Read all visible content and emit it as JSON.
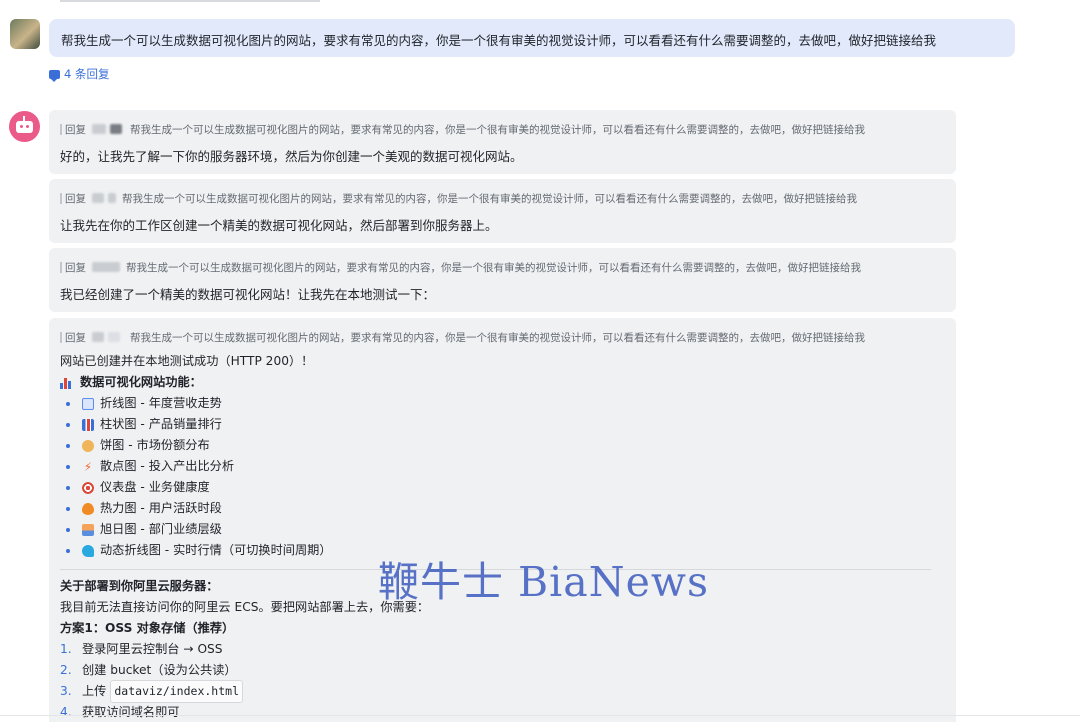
{
  "user_message": {
    "text": "帮我生成一个可以生成数据可视化图片的网站，要求有常见的内容，你是一个很有审美的视觉设计师，可以看看还有什么需要调整的，去做吧，做好把链接给我"
  },
  "thread": {
    "reply_count": "4 条回复"
  },
  "replies": [
    {
      "quote_prefix": "回复",
      "quote_text": "帮我生成一个可以生成数据可视化图片的网站，要求有常见的内容，你是一个很有审美的视觉设计师，可以看看还有什么需要调整的，去做吧，做好把链接给我",
      "text": "好的，让我先了解一下你的服务器环境，然后为你创建一个美观的数据可视化网站。"
    },
    {
      "quote_prefix": "回复",
      "quote_text": "帮我生成一个可以生成数据可视化图片的网站，要求有常见的内容，你是一个很有审美的视觉设计师，可以看看还有什么需要调整的，去做吧，做好把链接给我",
      "text": "让我先在你的工作区创建一个精美的数据可视化网站，然后部署到你服务器上。"
    },
    {
      "quote_prefix": "回复",
      "quote_text": "帮我生成一个可以生成数据可视化图片的网站，要求有常见的内容，你是一个很有审美的视觉设计师，可以看看还有什么需要调整的，去做吧，做好把链接给我",
      "text": "我已经创建了一个精美的数据可视化网站！让我先在本地测试一下："
    },
    {
      "quote_prefix": "回复",
      "quote_text": "帮我生成一个可以生成数据可视化图片的网站，要求有常见的内容，你是一个很有审美的视觉设计师，可以看看还有什么需要调整的，去做吧，做好把链接给我",
      "status_line": "网站已创建并在本地测试成功（HTTP 200）！",
      "features_heading": "数据可视化网站功能：",
      "features": [
        {
          "icon": "line-chart-icon",
          "color": "#5b8def",
          "text": "折线图 - 年度营收走势"
        },
        {
          "icon": "bar-chart-icon",
          "color": "#3a6fd8",
          "text": "柱状图 - 产品销量排行"
        },
        {
          "icon": "pie-chart-icon",
          "color": "#f0b45a",
          "text": "饼图 - 市场份额分布"
        },
        {
          "icon": "lightning-icon",
          "color": "#f06a3a",
          "text": "散点图 - 投入产出比分析"
        },
        {
          "icon": "target-icon",
          "color": "#e0453a",
          "text": "仪表盘 - 业务健康度"
        },
        {
          "icon": "fire-icon",
          "color": "#f08a24",
          "text": "热力图 - 用户活跃时段"
        },
        {
          "icon": "sunrise-icon",
          "color": "#f07a5a",
          "text": "旭日图 - 部门业绩层级"
        },
        {
          "icon": "wave-icon",
          "color": "#2aa8e0",
          "text": "动态折线图 - 实时行情（可切换时间周期）"
        }
      ],
      "deploy_heading": "关于部署到你阿里云服务器：",
      "deploy_intro": "我目前无法直接访问你的阿里云 ECS。要把网站部署上去，你需要：",
      "plan_title": "方案1：OSS 对象存储（推荐）",
      "steps": [
        {
          "n": "1.",
          "text": "登录阿里云控制台 → OSS"
        },
        {
          "n": "2.",
          "text": "创建 bucket（设为公共读）"
        },
        {
          "n": "3.",
          "text": "上传",
          "code": "dataviz/index.html"
        },
        {
          "n": "4.",
          "text": "获取访问域名即可"
        }
      ]
    }
  ],
  "watermark": "鞭牛士 BiaNews"
}
